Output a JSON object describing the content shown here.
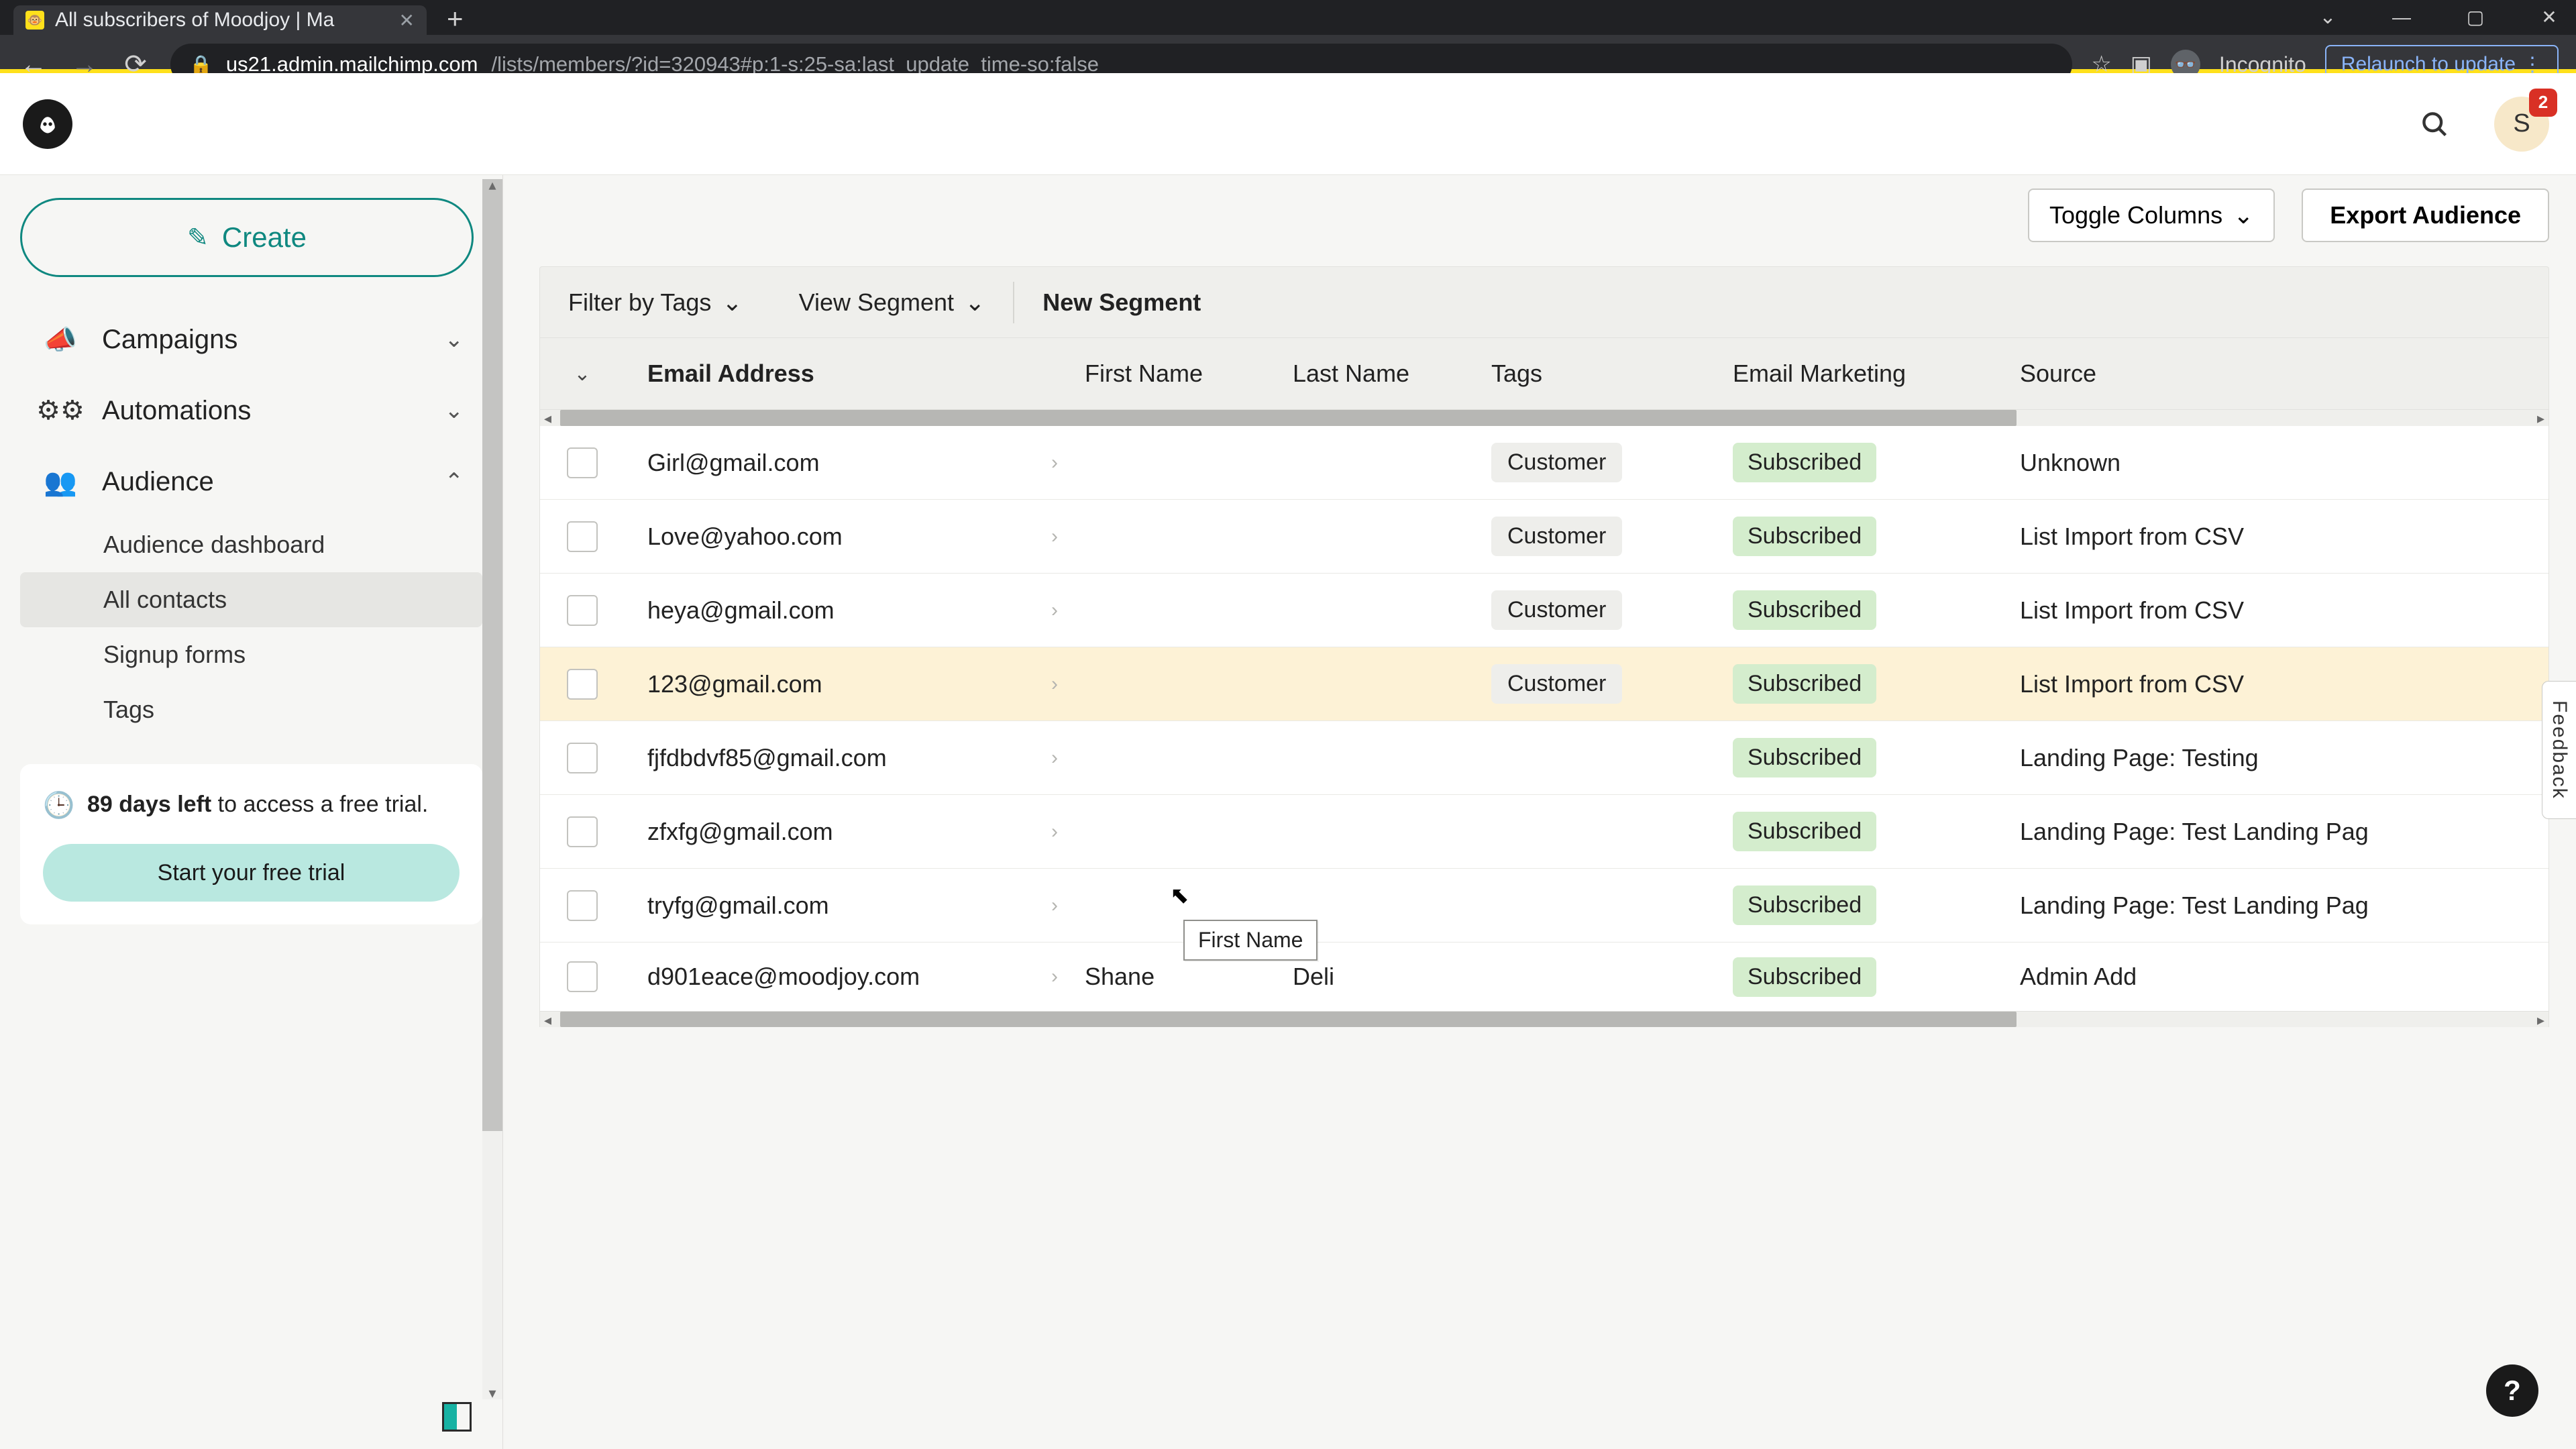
{
  "browser": {
    "tab_title": "All subscribers of Moodjoy | Ma",
    "url_host": "us21.admin.mailchimp.com",
    "url_path": "/lists/members/?id=320943#p:1-s:25-sa:last_update_time-so:false",
    "incognito_label": "Incognito",
    "relaunch_label": "Relaunch to update"
  },
  "header": {
    "avatar_initial": "S",
    "badge_count": "2"
  },
  "sidebar": {
    "create_label": "Create",
    "nav": {
      "campaigns": "Campaigns",
      "automations": "Automations",
      "audience": "Audience"
    },
    "sub": {
      "dashboard": "Audience dashboard",
      "all_contacts": "All contacts",
      "signup": "Signup forms",
      "tags": "Tags"
    },
    "trial": {
      "bold": "89 days left",
      "rest": " to access a free trial.",
      "btn": "Start your free trial"
    }
  },
  "toolbar": {
    "toggle_columns": "Toggle Columns",
    "export": "Export Audience",
    "filter_tags": "Filter by Tags",
    "view_segment": "View Segment",
    "new_segment": "New Segment"
  },
  "columns": {
    "email": "Email Address",
    "first_name": "First Name",
    "last_name": "Last Name",
    "tags": "Tags",
    "email_marketing": "Email Marketing",
    "source": "Source"
  },
  "tooltip": {
    "first_name": "First Name"
  },
  "rows": [
    {
      "email": "Girl@gmail.com",
      "first_name": "",
      "last_name": "",
      "tag": "Customer",
      "status": "Subscribed",
      "source": "Unknown"
    },
    {
      "email": "Love@yahoo.com",
      "first_name": "",
      "last_name": "",
      "tag": "Customer",
      "status": "Subscribed",
      "source": "List Import from CSV"
    },
    {
      "email": "heya@gmail.com",
      "first_name": "",
      "last_name": "",
      "tag": "Customer",
      "status": "Subscribed",
      "source": "List Import from CSV"
    },
    {
      "email": "123@gmail.com",
      "first_name": "",
      "last_name": "",
      "tag": "Customer",
      "status": "Subscribed",
      "source": "List Import from CSV"
    },
    {
      "email": "fjfdbdvf85@gmail.com",
      "first_name": "",
      "last_name": "",
      "tag": "",
      "status": "Subscribed",
      "source": "Landing Page:   Testing"
    },
    {
      "email": "zfxfg@gmail.com",
      "first_name": "",
      "last_name": "",
      "tag": "",
      "status": "Subscribed",
      "source": "Landing Page:   Test Landing Pag"
    },
    {
      "email": "tryfg@gmail.com",
      "first_name": "",
      "last_name": "",
      "tag": "",
      "status": "Subscribed",
      "source": "Landing Page:   Test Landing Pag"
    },
    {
      "email": "d901eace@moodjoy.com",
      "first_name": "Shane",
      "last_name": "Deli",
      "tag": "",
      "status": "Subscribed",
      "source": "Admin Add"
    }
  ],
  "feedback_label": "Feedback",
  "help_label": "?"
}
